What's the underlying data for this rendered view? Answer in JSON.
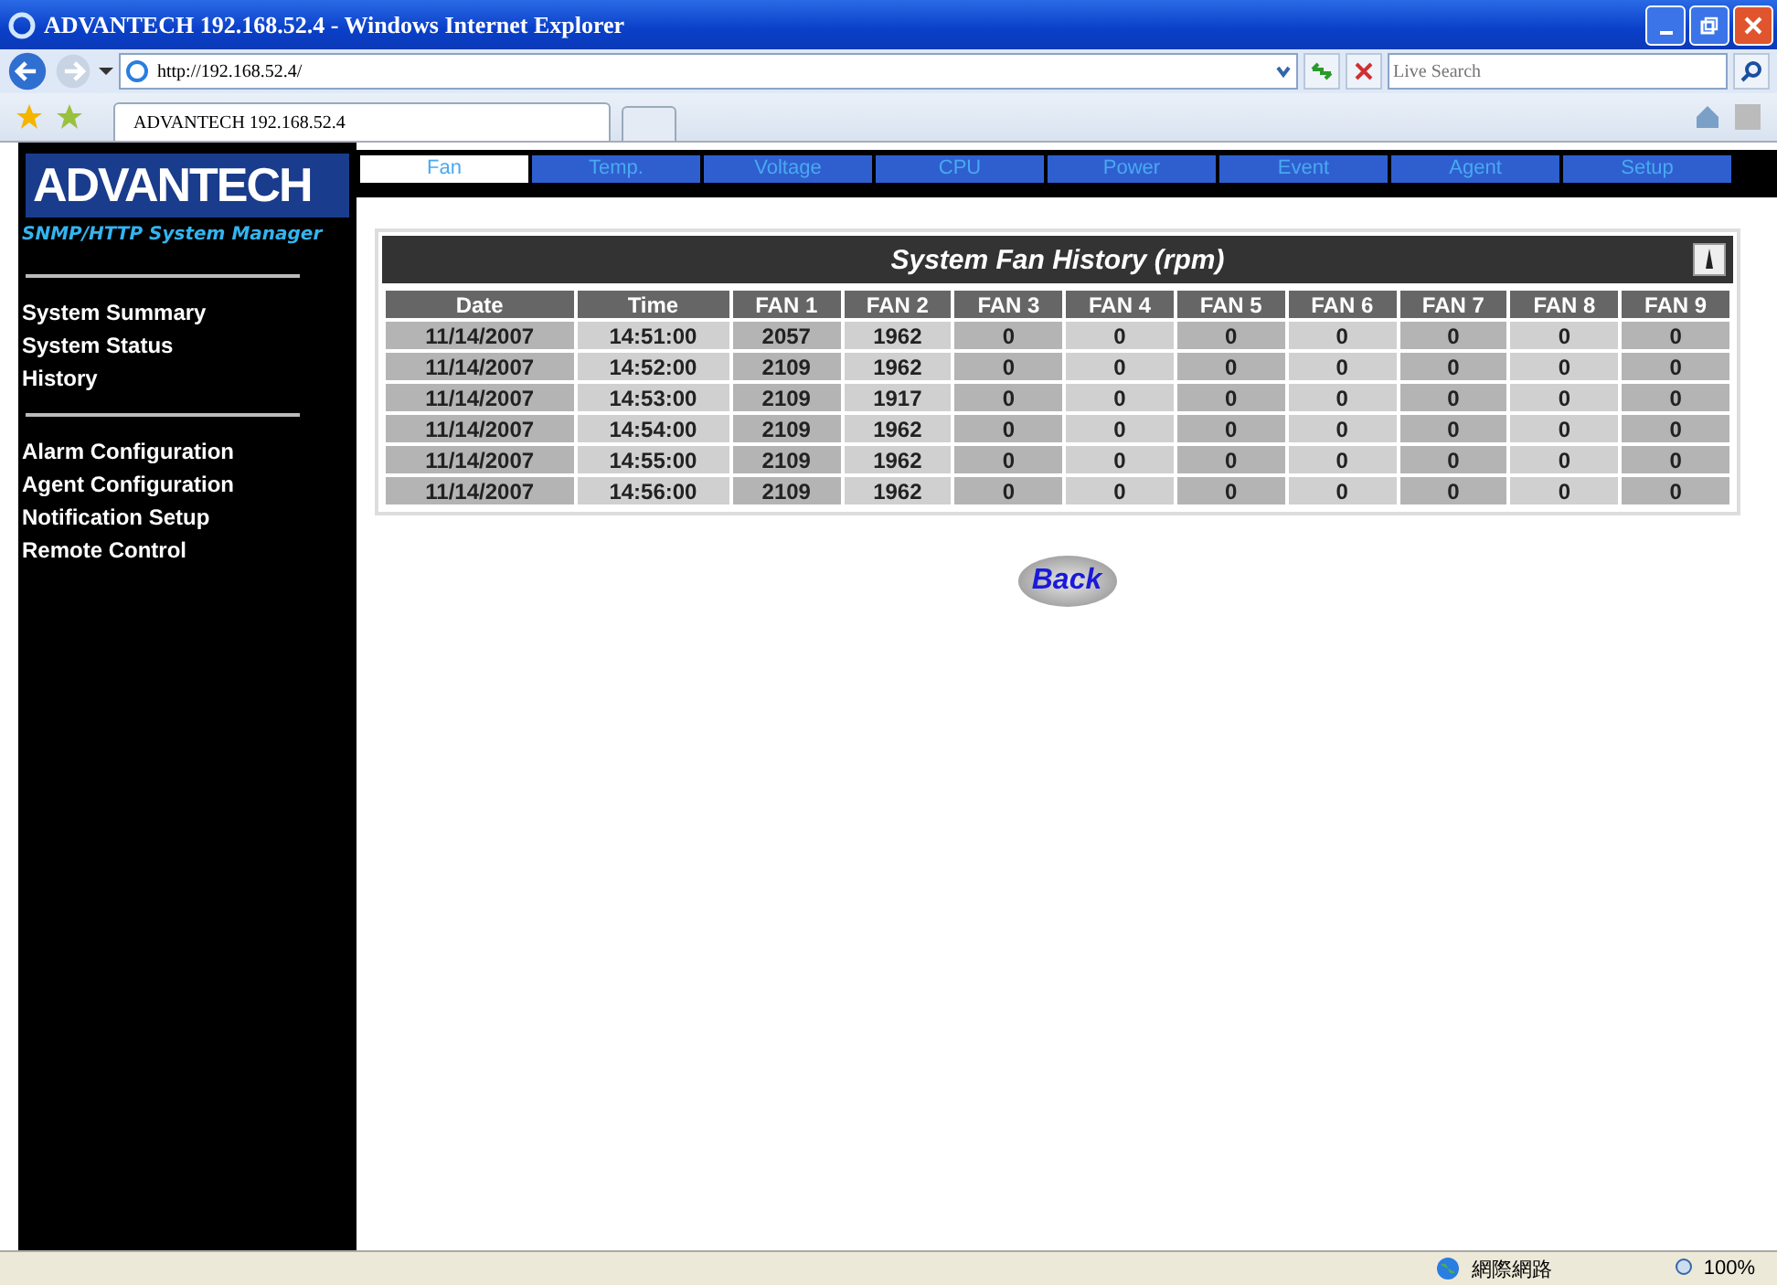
{
  "window": {
    "title": "ADVANTECH 192.168.52.4 - Windows Internet Explorer"
  },
  "address_bar": {
    "url": "http://192.168.52.4/"
  },
  "search": {
    "placeholder": "Live Search"
  },
  "browser_tabs": [
    {
      "label": "ADVANTECH 192.168.52.4",
      "selected": true
    }
  ],
  "logo": {
    "text": "ADVANTECH",
    "subtitle": "SNMP/HTTP System Manager"
  },
  "sidebar": {
    "groups": [
      [
        "System Summary",
        "System Status",
        "History"
      ],
      [
        "Alarm Configuration",
        "Agent Configuration",
        "Notification Setup",
        "Remote Control"
      ]
    ]
  },
  "tabs": [
    {
      "label": "Fan",
      "selected": true
    },
    {
      "label": "Temp.",
      "selected": false
    },
    {
      "label": "Voltage",
      "selected": false
    },
    {
      "label": "CPU",
      "selected": false
    },
    {
      "label": "Power",
      "selected": false
    },
    {
      "label": "Event",
      "selected": false
    },
    {
      "label": "Agent",
      "selected": false
    },
    {
      "label": "Setup",
      "selected": false
    }
  ],
  "table": {
    "title": "System Fan History (rpm)",
    "columns": [
      "Date",
      "Time",
      "FAN 1",
      "FAN 2",
      "FAN 3",
      "FAN 4",
      "FAN 5",
      "FAN 6",
      "FAN 7",
      "FAN 8",
      "FAN 9"
    ],
    "rows": [
      [
        "11/14/2007",
        "14:51:00",
        "2057",
        "1962",
        "0",
        "0",
        "0",
        "0",
        "0",
        "0",
        "0"
      ],
      [
        "11/14/2007",
        "14:52:00",
        "2109",
        "1962",
        "0",
        "0",
        "0",
        "0",
        "0",
        "0",
        "0"
      ],
      [
        "11/14/2007",
        "14:53:00",
        "2109",
        "1917",
        "0",
        "0",
        "0",
        "0",
        "0",
        "0",
        "0"
      ],
      [
        "11/14/2007",
        "14:54:00",
        "2109",
        "1962",
        "0",
        "0",
        "0",
        "0",
        "0",
        "0",
        "0"
      ],
      [
        "11/14/2007",
        "14:55:00",
        "2109",
        "1962",
        "0",
        "0",
        "0",
        "0",
        "0",
        "0",
        "0"
      ],
      [
        "11/14/2007",
        "14:56:00",
        "2109",
        "1962",
        "0",
        "0",
        "0",
        "0",
        "0",
        "0",
        "0"
      ]
    ]
  },
  "back_button": {
    "label": "Back"
  },
  "status_bar": {
    "zone": "網際網路",
    "zoom": "100%"
  }
}
